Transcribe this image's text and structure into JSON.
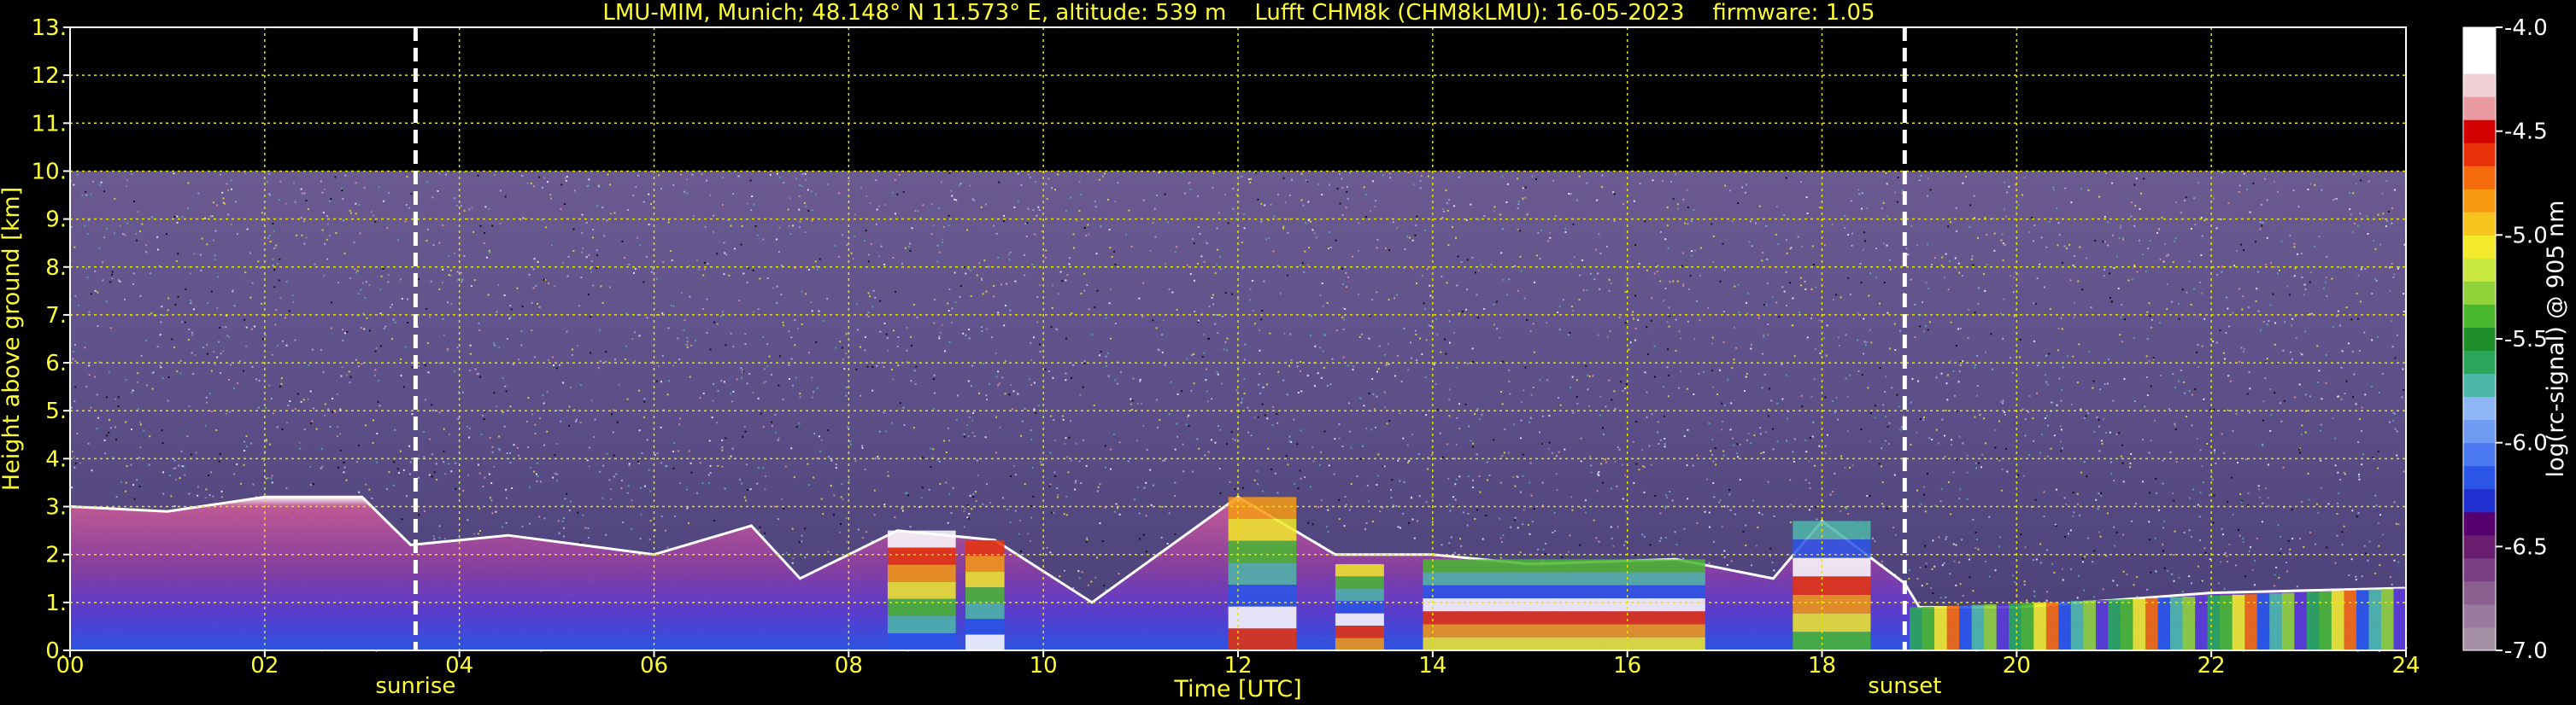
{
  "title": "LMU-MIM, Munich; 48.148° N 11.573° E, altitude: 539 m    Lufft CHM8k (CHM8kLMU): 16-05-2023    firmware: 1.05",
  "colors": {
    "background": "#000000",
    "text": "#ffff33",
    "grid": "#e6e600",
    "marker_lines": "#ffffff",
    "colorbar_text": "#ffffff"
  },
  "chart_data": {
    "type": "heatmap",
    "xlabel": "Time [UTC]",
    "ylabel": "Height above ground [km]",
    "xlim": [
      0,
      24
    ],
    "ylim": [
      0,
      13
    ],
    "x_ticks": [
      "00",
      "02",
      "04",
      "06",
      "08",
      "10",
      "12",
      "14",
      "16",
      "18",
      "20",
      "22",
      "24"
    ],
    "x_tick_values": [
      0,
      2,
      4,
      6,
      8,
      10,
      12,
      14,
      16,
      18,
      20,
      22,
      24
    ],
    "y_ticks": [
      "0.",
      "1.",
      "2.",
      "3.",
      "4.",
      "5.",
      "6.",
      "7.",
      "8.",
      "9.",
      "10.",
      "11.",
      "12.",
      "13."
    ],
    "y_tick_values": [
      0,
      1,
      2,
      3,
      4,
      5,
      6,
      7,
      8,
      9,
      10,
      11,
      12,
      13
    ],
    "grid": true,
    "markers": [
      {
        "label": "sunrise",
        "x": 3.55
      },
      {
        "label": "sunset",
        "x": 18.85
      }
    ],
    "signal_max_height_km": 10.0,
    "boundary_layer_top_km": [
      {
        "x": 0.0,
        "y": 3.0
      },
      {
        "x": 1.0,
        "y": 2.9
      },
      {
        "x": 2.0,
        "y": 3.2
      },
      {
        "x": 3.0,
        "y": 3.2
      },
      {
        "x": 3.5,
        "y": 2.2
      },
      {
        "x": 4.5,
        "y": 2.4
      },
      {
        "x": 6.0,
        "y": 2.0
      },
      {
        "x": 7.0,
        "y": 2.6
      },
      {
        "x": 7.5,
        "y": 1.5
      },
      {
        "x": 8.5,
        "y": 2.5
      },
      {
        "x": 9.5,
        "y": 2.3
      },
      {
        "x": 10.5,
        "y": 1.0
      },
      {
        "x": 12.0,
        "y": 3.2
      },
      {
        "x": 13.0,
        "y": 2.0
      },
      {
        "x": 14.0,
        "y": 2.0
      },
      {
        "x": 15.0,
        "y": 1.8
      },
      {
        "x": 16.5,
        "y": 1.9
      },
      {
        "x": 17.5,
        "y": 1.5
      },
      {
        "x": 18.0,
        "y": 2.7
      },
      {
        "x": 18.85,
        "y": 1.4
      },
      {
        "x": 19.0,
        "y": 0.9
      },
      {
        "x": 20.0,
        "y": 0.9
      },
      {
        "x": 22.0,
        "y": 1.2
      },
      {
        "x": 24.0,
        "y": 1.3
      }
    ],
    "colorbar": {
      "label": "log(rc-signal) @ 905 nm",
      "range": [
        -7.0,
        -4.0
      ],
      "ticks": [
        "-4.0",
        "-4.5",
        "-5.0",
        "-5.5",
        "-6.0",
        "-6.5",
        "-7.0"
      ],
      "tick_values": [
        -4.0,
        -4.5,
        -5.0,
        -5.5,
        -6.0,
        -6.5,
        -7.0
      ],
      "colors_bottom_to_top": [
        "#a58fa5",
        "#9a7a9e",
        "#8a5f8f",
        "#7a3f82",
        "#6a1e70",
        "#560070",
        "#1f2fd0",
        "#2a55e6",
        "#4a78f0",
        "#6f9af2",
        "#8fb6f4",
        "#4db8a8",
        "#2aa65a",
        "#1f8f2a",
        "#49b82f",
        "#8fd23a",
        "#c8e840",
        "#f2ea2a",
        "#f7c51e",
        "#f79a12",
        "#f46a0c",
        "#e8320a",
        "#d40000",
        "#e89aa0",
        "#f0d0d4",
        "#ffffff",
        "#ffffff"
      ]
    }
  }
}
